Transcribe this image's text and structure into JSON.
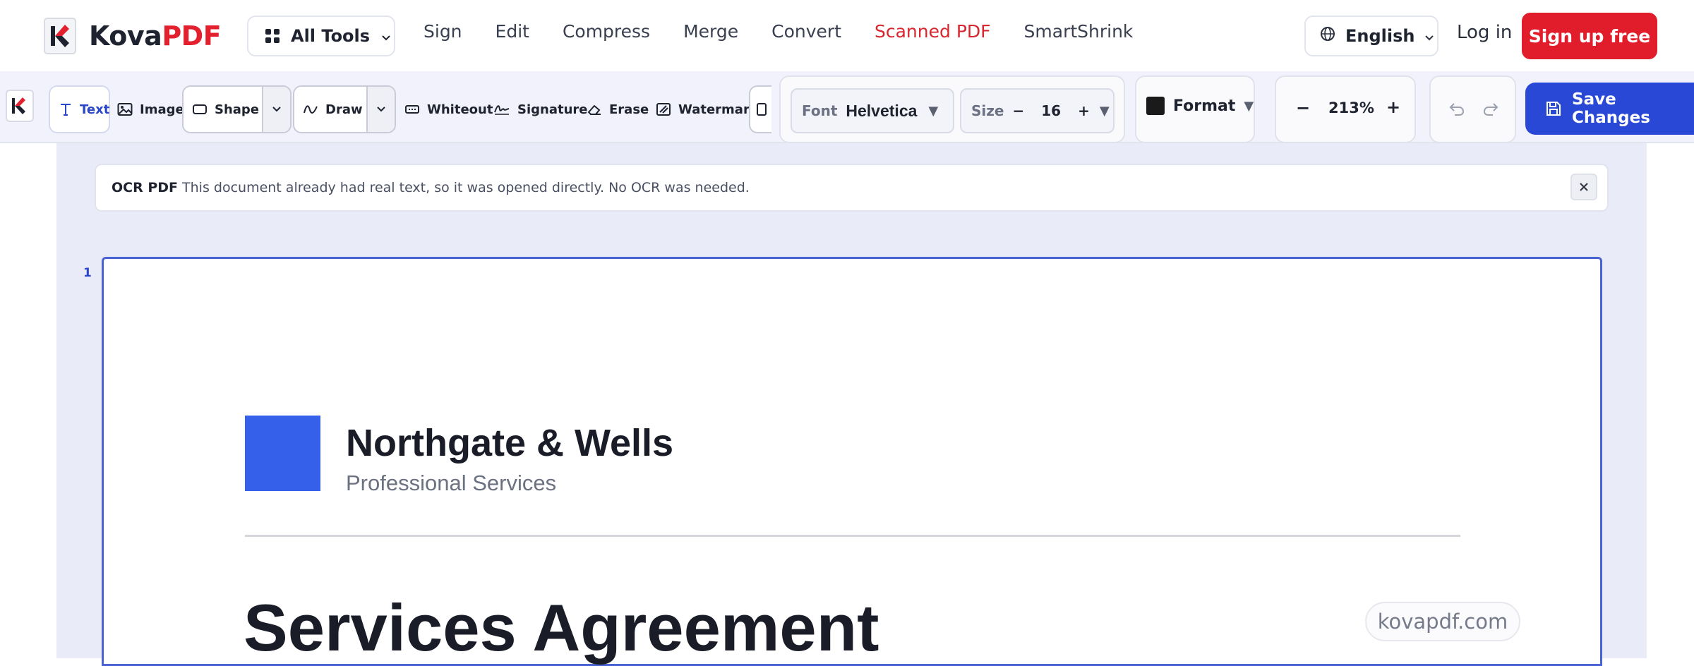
{
  "brand": {
    "name_part1": "Kova",
    "name_part2": "PDF",
    "accent": "#e3202e"
  },
  "nav": {
    "all_tools": "All Tools",
    "links": [
      "Sign",
      "Edit",
      "Compress",
      "Merge",
      "Convert",
      "Scanned PDF",
      "SmartShrink"
    ],
    "active_link": "Scanned PDF",
    "language": "English",
    "login": "Log in",
    "signup": "Sign up free"
  },
  "toolbar": {
    "tools": {
      "text": "Text",
      "image": "Image",
      "shape": "Shape",
      "draw": "Draw",
      "whiteout": "Whiteout",
      "signature": "Signature",
      "erase": "Erase",
      "watermark": "Watermark"
    },
    "font": {
      "label": "Font",
      "value": "Helvetica"
    },
    "size": {
      "label": "Size",
      "value": "16",
      "minus": "−",
      "plus": "+"
    },
    "format": {
      "label": "Format",
      "color": "#1a1a1a"
    },
    "zoom": {
      "minus": "−",
      "value": "213%",
      "plus": "+"
    },
    "save": "Save Changes",
    "save_color": "#2a48d6"
  },
  "banner": {
    "title": "OCR PDF",
    "message": "This document already had real text, so it was opened directly. No OCR was needed."
  },
  "document": {
    "page_number": "1",
    "company": "Northgate & Wells",
    "tagline": "Professional Services",
    "title": "Services Agreement",
    "watermark": "kovapdf.com",
    "brand_color": "#3560ea"
  }
}
